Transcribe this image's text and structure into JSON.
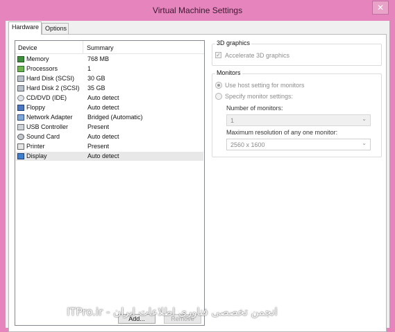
{
  "window": {
    "title": "Virtual Machine Settings",
    "close_glyph": "✕"
  },
  "tabs": [
    {
      "label": "Hardware"
    },
    {
      "label": "Options"
    }
  ],
  "device_table": {
    "headers": {
      "device": "Device",
      "summary": "Summary"
    },
    "rows": [
      {
        "device": "Memory",
        "summary": "768 MB",
        "icon": "memory-icon"
      },
      {
        "device": "Processors",
        "summary": "1",
        "icon": "processor-icon"
      },
      {
        "device": "Hard Disk (SCSI)",
        "summary": "30 GB",
        "icon": "hard-disk-icon"
      },
      {
        "device": "Hard Disk 2 (SCSI)",
        "summary": "35 GB",
        "icon": "hard-disk-icon"
      },
      {
        "device": "CD/DVD (IDE)",
        "summary": "Auto detect",
        "icon": "cd-dvd-icon"
      },
      {
        "device": "Floppy",
        "summary": "Auto detect",
        "icon": "floppy-icon"
      },
      {
        "device": "Network Adapter",
        "summary": "Bridged (Automatic)",
        "icon": "network-adapter-icon"
      },
      {
        "device": "USB Controller",
        "summary": "Present",
        "icon": "usb-icon"
      },
      {
        "device": "Sound Card",
        "summary": "Auto detect",
        "icon": "sound-card-icon"
      },
      {
        "device": "Printer",
        "summary": "Present",
        "icon": "printer-icon"
      },
      {
        "device": "Display",
        "summary": "Auto detect",
        "icon": "display-icon",
        "selected": true
      }
    ]
  },
  "graphics_3d": {
    "legend": "3D graphics",
    "accelerate_label": "Accelerate 3D graphics",
    "accelerate_checked": true
  },
  "monitors": {
    "legend": "Monitors",
    "use_host_label": "Use host setting for monitors",
    "specify_label": "Specify monitor settings:",
    "number_label": "Number of monitors:",
    "number_value": "1",
    "max_res_label": "Maximum resolution of any one monitor:",
    "max_res_value": "2560 x 1600"
  },
  "buttons": {
    "add": "Add...",
    "remove": "Remove"
  },
  "watermark": "ITPro.ir - انجمن تخصصی فناوری اطلاعات ایران"
}
